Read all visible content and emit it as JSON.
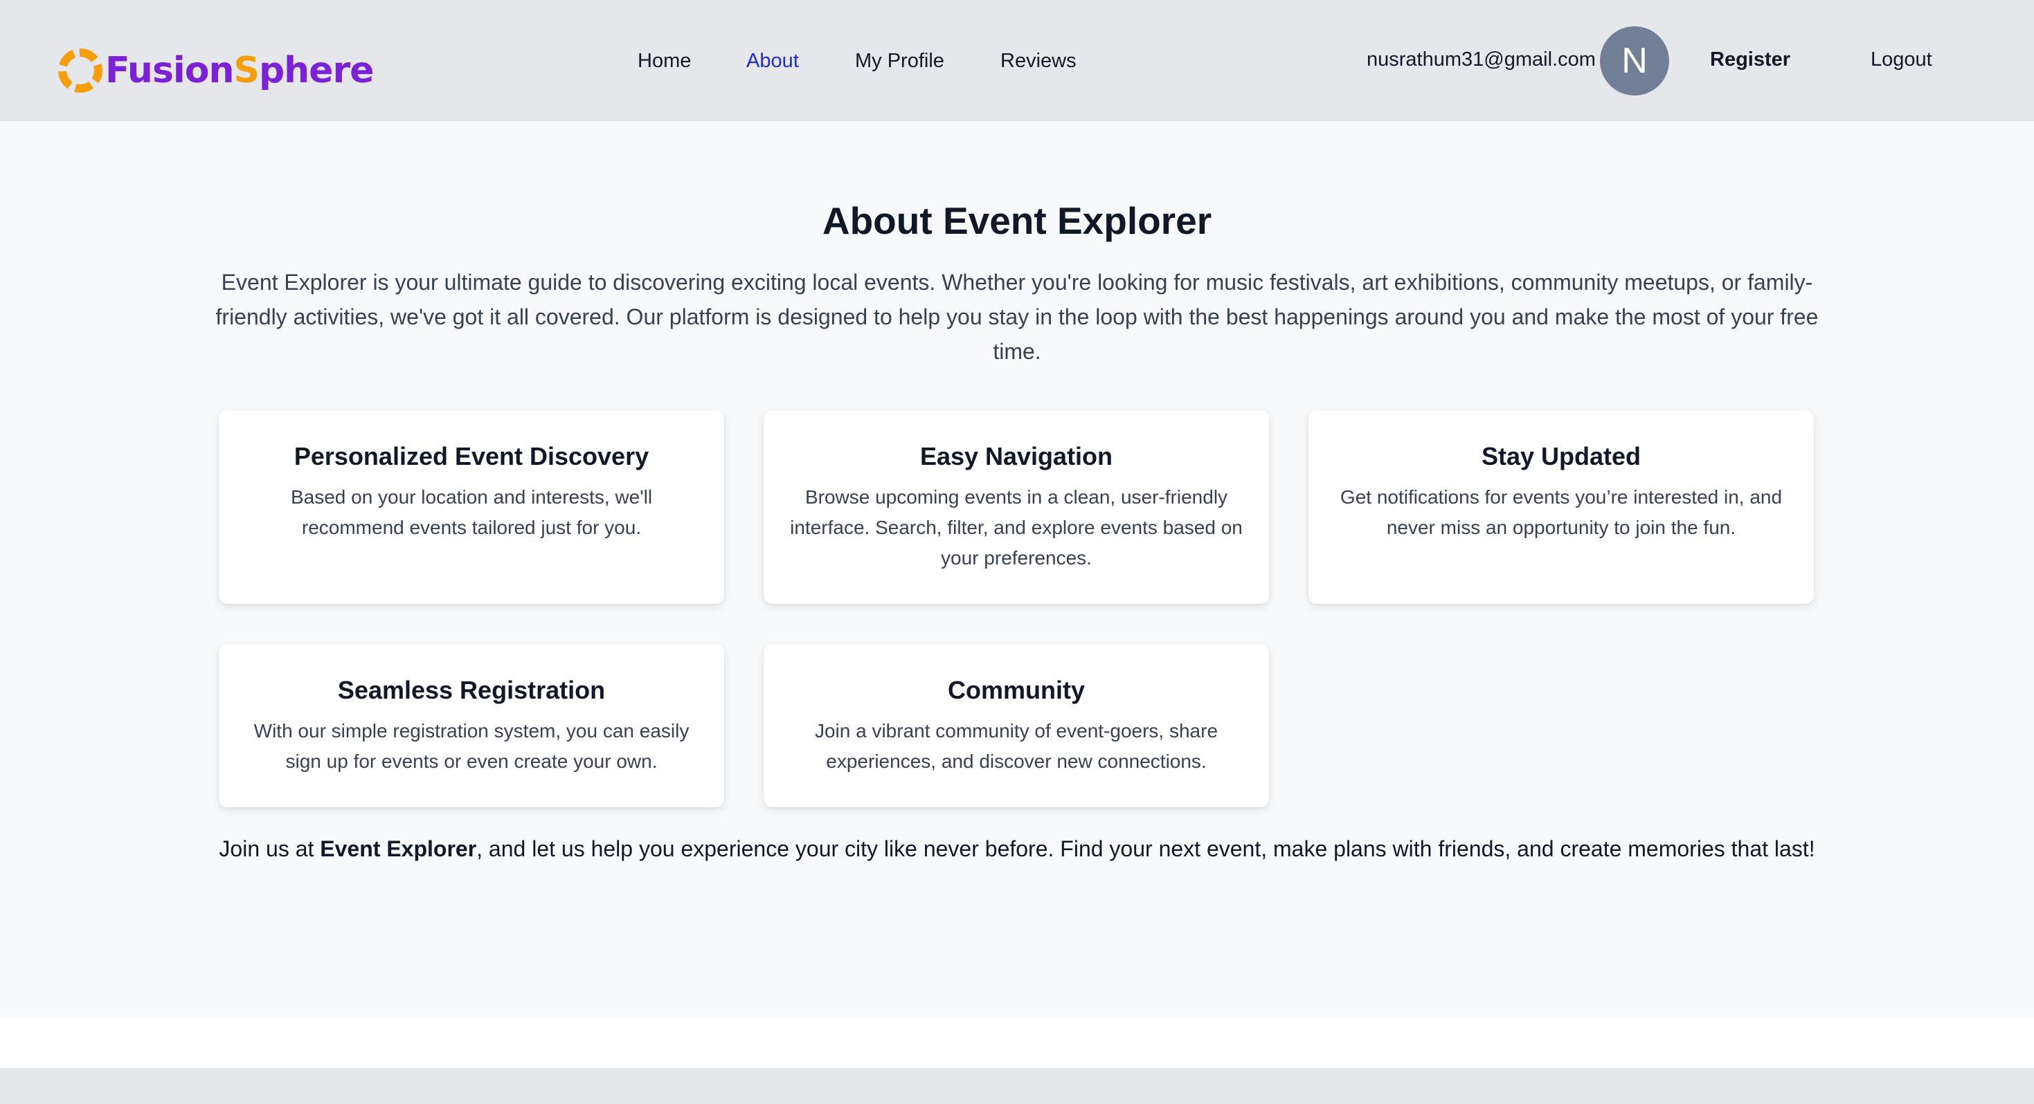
{
  "brand": {
    "name_part1": "Fusion",
    "name_part2": "S",
    "name_part3": "phere",
    "accent_color": "#f59e0b",
    "primary_color": "#7c22d6"
  },
  "nav": {
    "items": [
      {
        "label": "Home",
        "active": false
      },
      {
        "label": "About",
        "active": true
      },
      {
        "label": "My Profile",
        "active": false
      },
      {
        "label": "Reviews",
        "active": false
      }
    ],
    "active_color": "#1d2ad8"
  },
  "user": {
    "email": "nusrathum31@gmail.com",
    "avatar_initial": "N"
  },
  "auth": {
    "register_label": "Register",
    "logout_label": "Logout"
  },
  "about": {
    "title": "About Event Explorer",
    "intro": "Event Explorer is your ultimate guide to discovering exciting local events. Whether you're looking for music festivals, art exhibitions, community meetups, or family-friendly activities, we've got it all covered. Our platform is designed to help you stay in the loop with the best happenings around you and make the most of your free time.",
    "features": [
      {
        "title": "Personalized Event Discovery",
        "text": "Based on your location and interests, we'll recommend events tailored just for you."
      },
      {
        "title": "Easy Navigation",
        "text": "Browse upcoming events in a clean, user-friendly interface. Search, filter, and explore events based on your preferences."
      },
      {
        "title": "Stay Updated",
        "text": "Get notifications for events you’re interested in, and never miss an opportunity to join the fun."
      },
      {
        "title": "Seamless Registration",
        "text": "With our simple registration system, you can easily sign up for events or even create your own."
      },
      {
        "title": "Community",
        "text": "Join a vibrant community of event-goers, share experiences, and discover new connections."
      }
    ],
    "closing_prefix": "Join us at ",
    "closing_brand": "Event Explorer",
    "closing_suffix": ", and let us help you experience your city like never before. Find your next event, make plans with friends, and create memories that last!"
  }
}
